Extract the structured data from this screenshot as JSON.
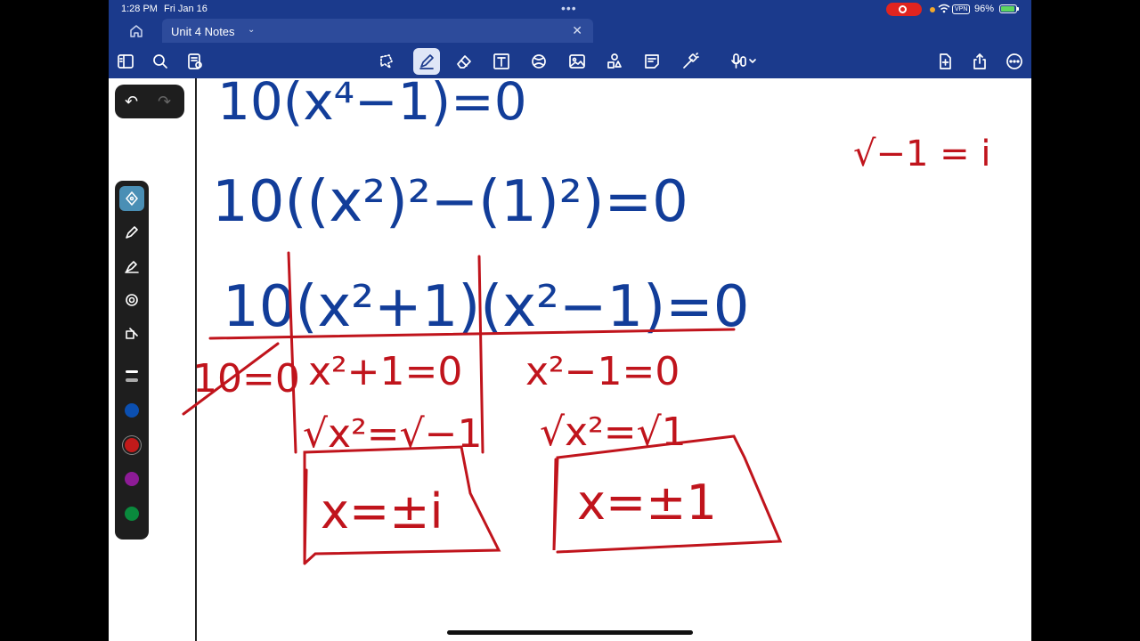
{
  "status": {
    "time": "1:28 PM",
    "date": "Fri Jan 16",
    "dots": "•••",
    "vpn": "VPN",
    "battery_pct": "96%",
    "battery_level": 0.96
  },
  "tab": {
    "title": "Unit 4 Notes",
    "close": "✕"
  },
  "colors": {
    "bar": "#1b3a8c",
    "ink_blue": "#123d99",
    "ink_red": "#c0141c",
    "swatches": [
      "#0b4fb0",
      "#c11a1a",
      "#8d1b96",
      "#0a8a3d"
    ]
  },
  "icons": {
    "toolbar_left": [
      "sidebar-icon",
      "search-icon",
      "page-options-icon"
    ],
    "toolbar_center": [
      "lasso-icon",
      "pen-icon",
      "eraser-icon",
      "text-icon",
      "shapes-icon",
      "image-icon",
      "elements-icon",
      "sticky-note-icon",
      "laser-icon",
      "audio-icon"
    ],
    "toolbar_right": [
      "add-page-icon",
      "share-icon",
      "more-icon"
    ]
  },
  "notes": {
    "line1": "10(x⁴−1)=0",
    "line2": "10((x²)²−(1)²)=0",
    "line3": "10(x²+1)(x²−1)=0",
    "col1": "10=0",
    "col2a": "x²+1=0",
    "col2b": "√x²=√−1",
    "col2c": "x=±i",
    "col3a": "x²−1=0",
    "col3b": "√x²=√1",
    "col3c": "x=±1",
    "side": "√−1 = i"
  }
}
